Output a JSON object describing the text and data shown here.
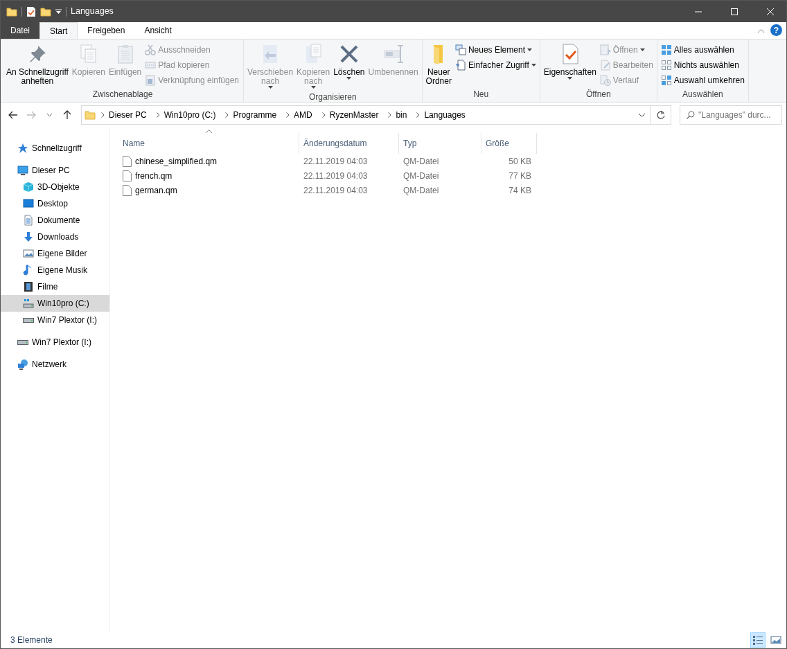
{
  "window": {
    "title": "Languages"
  },
  "ribbon_tabs": [
    {
      "label": "Datei",
      "kind": "file",
      "selected": false
    },
    {
      "label": "Start",
      "kind": "tab",
      "selected": true
    },
    {
      "label": "Freigeben",
      "kind": "tab",
      "selected": false
    },
    {
      "label": "Ansicht",
      "kind": "tab",
      "selected": false
    }
  ],
  "help": "?",
  "ribbon_groups": [
    {
      "label": "Zwischenablage",
      "commands": [
        {
          "label": "An Schnellzugriff\nanheften",
          "kind": "large",
          "disabled": false,
          "dropdown": false
        },
        {
          "label": "Kopieren",
          "kind": "large",
          "disabled": true,
          "dropdown": false
        },
        {
          "label": "Einfügen",
          "kind": "large",
          "disabled": true,
          "dropdown": false
        },
        {
          "label": "Ausschneiden",
          "kind": "small",
          "disabled": true,
          "dropdown": false
        },
        {
          "label": "Pfad kopieren",
          "kind": "small",
          "disabled": true,
          "dropdown": false
        },
        {
          "label": "Verknüpfung einfügen",
          "kind": "small",
          "disabled": true,
          "dropdown": false
        }
      ]
    },
    {
      "label": "Organisieren",
      "commands": [
        {
          "label": "Verschieben\nnach",
          "kind": "large",
          "disabled": true,
          "dropdown": true
        },
        {
          "label": "Kopieren\nnach",
          "kind": "large",
          "disabled": true,
          "dropdown": true
        },
        {
          "label": "Löschen",
          "kind": "large",
          "disabled": false,
          "dropdown": true
        },
        {
          "label": "Umbenennen",
          "kind": "large",
          "disabled": true,
          "dropdown": false
        }
      ]
    },
    {
      "label": "Neu",
      "commands": [
        {
          "label": "Neuer\nOrdner",
          "kind": "large",
          "disabled": false,
          "dropdown": false
        },
        {
          "label": "Neues Element",
          "kind": "small",
          "disabled": false,
          "dropdown": true
        },
        {
          "label": "Einfacher Zugriff",
          "kind": "small",
          "disabled": false,
          "dropdown": true
        }
      ]
    },
    {
      "label": "Öffnen",
      "commands": [
        {
          "label": "Eigenschaften",
          "kind": "large",
          "disabled": false,
          "dropdown": true
        },
        {
          "label": "Öffnen",
          "kind": "small",
          "disabled": true,
          "dropdown": true
        },
        {
          "label": "Bearbeiten",
          "kind": "small",
          "disabled": true,
          "dropdown": false
        },
        {
          "label": "Verlauf",
          "kind": "small",
          "disabled": true,
          "dropdown": false
        }
      ]
    },
    {
      "label": "Auswählen",
      "commands": [
        {
          "label": "Alles auswählen",
          "kind": "small",
          "disabled": false,
          "dropdown": false
        },
        {
          "label": "Nichts auswählen",
          "kind": "small",
          "disabled": false,
          "dropdown": false
        },
        {
          "label": "Auswahl umkehren",
          "kind": "small",
          "disabled": false,
          "dropdown": false
        }
      ]
    }
  ],
  "address": {
    "path": [
      "Dieser PC",
      "Win10pro (C:)",
      "Programme",
      "AMD",
      "RyzenMaster",
      "bin",
      "Languages"
    ],
    "search_placeholder": "\"Languages\" durc..."
  },
  "navigation": [
    {
      "label": "Schnellzugriff",
      "selected": false
    },
    {
      "label": "Dieser PC",
      "selected": false,
      "children": [
        {
          "label": "3D-Objekte",
          "selected": false
        },
        {
          "label": "Desktop",
          "selected": false
        },
        {
          "label": "Dokumente",
          "selected": false
        },
        {
          "label": "Downloads",
          "selected": false
        },
        {
          "label": "Eigene Bilder",
          "selected": false
        },
        {
          "label": "Eigene Musik",
          "selected": false
        },
        {
          "label": "Filme",
          "selected": false
        },
        {
          "label": "Win10pro (C:)",
          "selected": true
        },
        {
          "label": "Win7 Plextor (I:)",
          "selected": false
        }
      ]
    },
    {
      "label": "Win7 Plextor (I:)",
      "selected": false
    },
    {
      "label": "Netzwerk",
      "selected": false
    }
  ],
  "table": {
    "columns": [
      "Name",
      "Änderungsdatum",
      "Typ",
      "Größe"
    ],
    "rows": [
      [
        "chinese_simplified.qm",
        "22.11.2019 04:03",
        "QM-Datei",
        "50 KB"
      ],
      [
        "french.qm",
        "22.11.2019 04:03",
        "QM-Datei",
        "77 KB"
      ],
      [
        "german.qm",
        "22.11.2019 04:03",
        "QM-Datei",
        "74 KB"
      ]
    ]
  },
  "status_bar": {
    "count": "3 Elemente",
    "views": [
      {
        "kind": "details",
        "selected": true
      },
      {
        "kind": "large_icons",
        "selected": false
      }
    ]
  }
}
